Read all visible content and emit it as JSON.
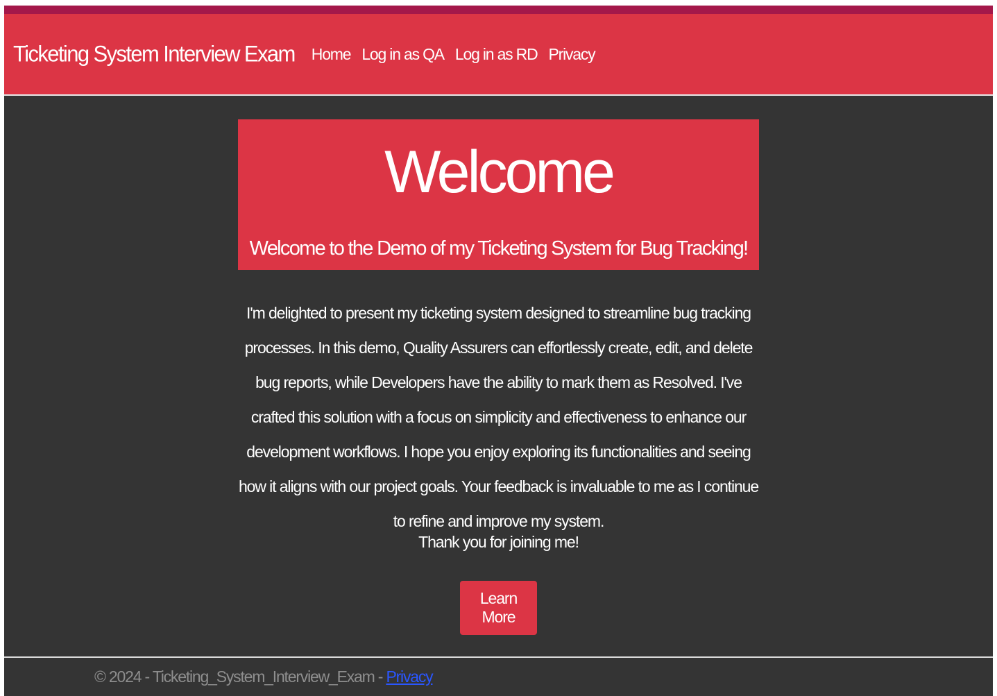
{
  "navbar": {
    "brand": "Ticketing System Interview Exam",
    "links": [
      {
        "label": "Home"
      },
      {
        "label": "Log in as QA"
      },
      {
        "label": "Log in as RD"
      },
      {
        "label": "Privacy"
      }
    ]
  },
  "hero": {
    "title": "Welcome",
    "subtitle": "Welcome to the Demo of my Ticketing System for Bug Tracking!"
  },
  "intro": {
    "paragraph": "I'm delighted to present my ticketing system designed to streamline bug tracking processes. In this demo, Quality Assurers can effortlessly create, edit, and delete bug reports, while Developers have the ability to mark them as Resolved. I've crafted this solution with a focus on simplicity and effectiveness to enhance our development workflows. I hope you enjoy exploring its functionalities and seeing how it aligns with our project goals. Your feedback is invaluable to me as I continue to refine and improve my system.",
    "thanks": "Thank you for joining me!"
  },
  "learn_more_button": {
    "label": "Learn More"
  },
  "footer": {
    "text": "© 2024 - Ticketing_System_Interview_Exam - ",
    "link_label": "Privacy"
  },
  "colors": {
    "primary": "#dc3545",
    "background": "#343434",
    "top_strip": "#a4184a",
    "footer_text": "#8e8e8e",
    "link": "#2a56ff"
  }
}
